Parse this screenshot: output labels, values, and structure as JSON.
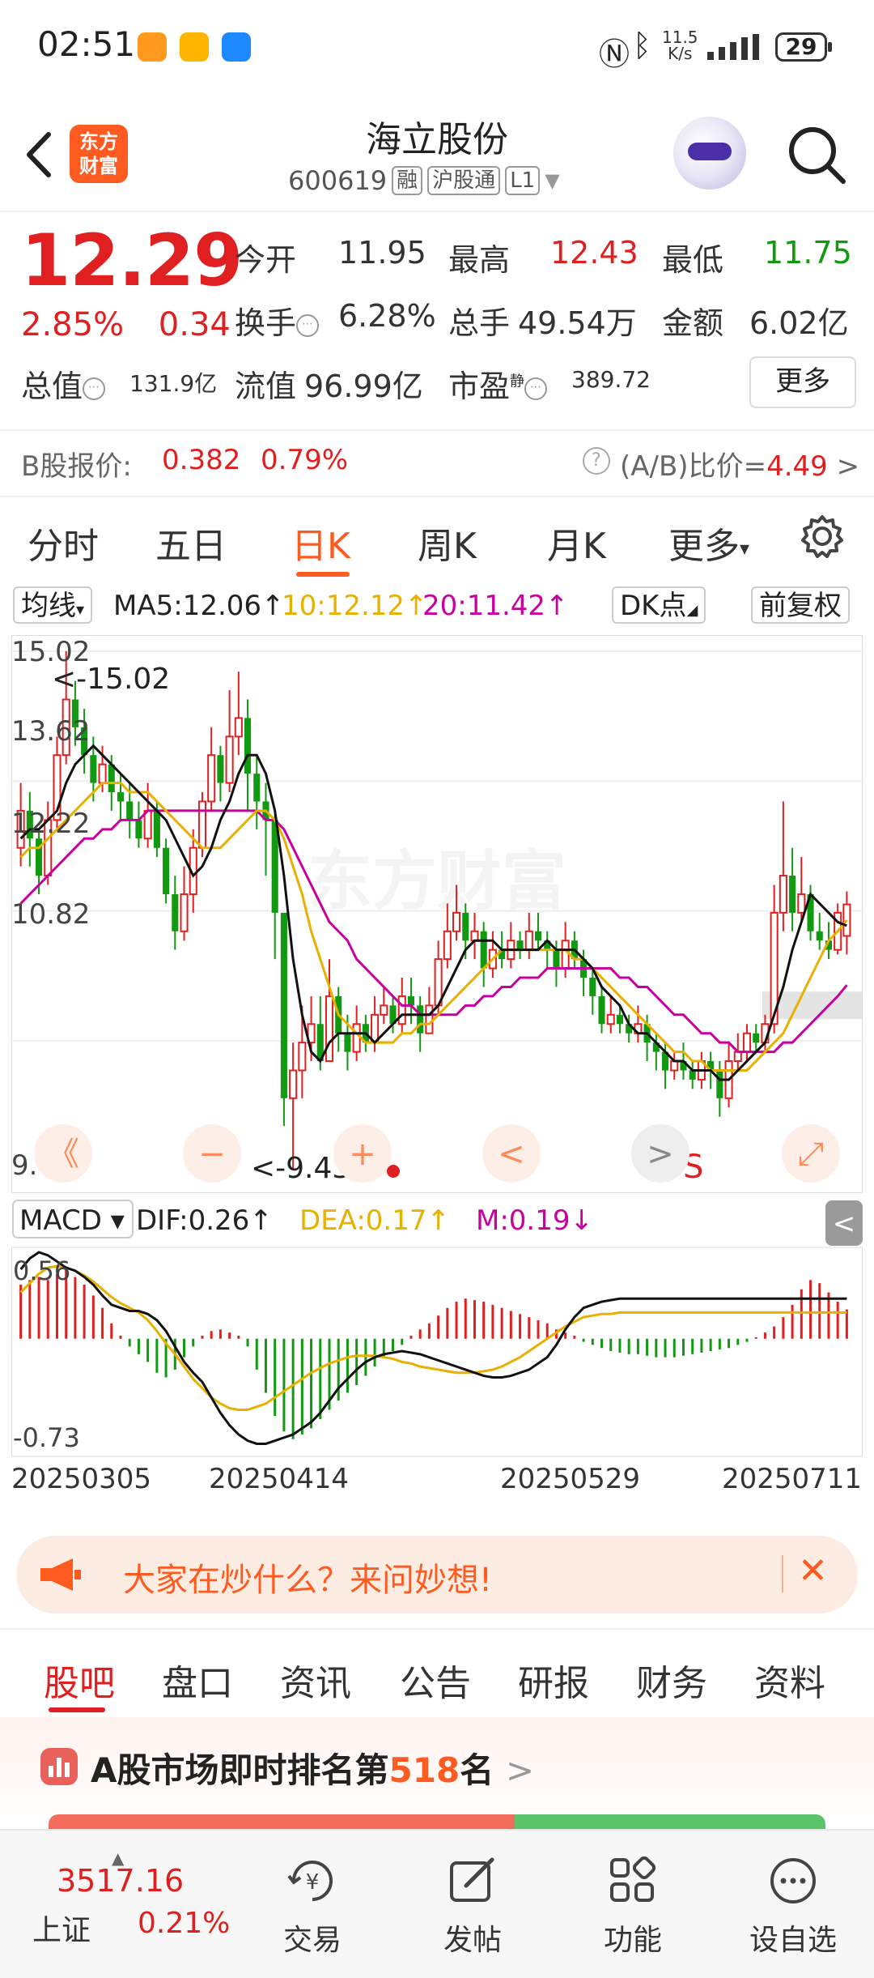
{
  "status_bar": {
    "time": "02:51",
    "net_speed": "11.5\nK/s",
    "net_speed_value": "11.5",
    "net_speed_unit": "K/s",
    "battery": "29"
  },
  "header": {
    "brand_logo_text": "东方财富",
    "brand_logo_line1": "东方",
    "brand_logo_line2": "财富",
    "title": "海立股份",
    "code": "600619",
    "tag_rong": "融",
    "tag_hgt": "沪股通",
    "tag_level": "L1"
  },
  "quote": {
    "price": "12.29",
    "change_pct": "2.85%",
    "change_amt": "0.34",
    "open_label": "今开",
    "open": "11.95",
    "high_label": "最高",
    "high": "12.43",
    "low_label": "最低",
    "low": "11.75",
    "turnover_label": "换手",
    "turnover": "6.28%",
    "volume_label": "总手",
    "volume": "49.54万",
    "amount_label": "金额",
    "amount": "6.02亿",
    "mktcap_label": "总值",
    "mktcap": "131.9亿",
    "float_label": "流值",
    "float_cap": "96.99亿",
    "pe_label": "市盈",
    "pe_sup": "静",
    "pe": "389.72",
    "more_button": "更多"
  },
  "bshare": {
    "label": "B股报价:",
    "price": "0.382",
    "pct": "0.79%",
    "ratio_label": "(A/B)比价=",
    "ratio": "4.49",
    "chevron": ">"
  },
  "period_tabs": [
    "分时",
    "五日",
    "日K",
    "周K",
    "月K",
    "更多"
  ],
  "period_active": "日K",
  "ma_row": {
    "indicator": "均线",
    "ma5": "MA5:12.06↑",
    "ma10": "10:12.12↑",
    "ma20": "20:11.42↑",
    "dk_button": "DK点",
    "adjust_button": "前复权"
  },
  "kline": {
    "axis_labels": [
      "15.02",
      "13.62",
      "12.22",
      "10.82",
      "9.43"
    ],
    "max_marker": "<-15.02",
    "min_marker": "<-9.43",
    "signal_mark": "S",
    "ctrl_rewind": "《",
    "ctrl_zoom_out": "−",
    "ctrl_zoom_in": "+",
    "ctrl_prev": "<",
    "ctrl_next": ">",
    "ctrl_expand": "⤢",
    "watermark": "东方财富"
  },
  "macd_row": {
    "indicator": "MACD",
    "dif": "DIF:0.26↑",
    "dea": "DEA:0.17↑",
    "m": "M:0.19↓",
    "axis_top": "0.56",
    "axis_bottom": "-0.73",
    "collapse": "<"
  },
  "dates": [
    "20250305",
    "20250414",
    "20250529",
    "20250711"
  ],
  "ad": {
    "text": "大家在炒什么？来问妙想!",
    "close": "✕"
  },
  "bottom_tabs": [
    "股吧",
    "盘口",
    "资讯",
    "公告",
    "研报",
    "财务",
    "资料"
  ],
  "bottom_tab_active": "股吧",
  "rank": {
    "prefix": "A股市场即时排名第",
    "value": "518",
    "suffix": "名",
    "chevron": ">"
  },
  "bottom_nav": {
    "index_value": "3517.16",
    "index_name": "上证",
    "index_pct": "0.21%",
    "items": [
      "交易",
      "发帖",
      "功能",
      "设自选"
    ]
  },
  "colors": {
    "up": "#e02020",
    "down": "#119911",
    "accent": "#ff5a1f",
    "ma5": "#111111",
    "ma10": "#e8b000",
    "ma20": "#c8009f"
  },
  "chart_data": {
    "type": "candlestick",
    "title": "",
    "ylim": [
      9.43,
      15.02
    ],
    "x_labels": [
      "20250305",
      "20250414",
      "20250529",
      "20250711"
    ],
    "candles": [
      [
        12.9,
        13.3,
        13.6,
        12.7
      ],
      [
        13.3,
        13.0,
        13.5,
        12.7
      ],
      [
        13.0,
        12.6,
        13.1,
        12.4
      ],
      [
        12.6,
        13.2,
        13.4,
        12.5
      ],
      [
        13.2,
        13.9,
        14.1,
        13.1
      ],
      [
        13.9,
        14.5,
        15.02,
        13.8
      ],
      [
        14.5,
        14.2,
        14.7,
        14.0
      ],
      [
        14.2,
        13.9,
        14.4,
        13.7
      ],
      [
        13.9,
        13.6,
        14.1,
        13.4
      ],
      [
        13.6,
        13.8,
        14.0,
        13.5
      ],
      [
        13.8,
        13.5,
        13.9,
        13.3
      ],
      [
        13.5,
        13.4,
        13.7,
        13.2
      ],
      [
        13.4,
        13.2,
        13.6,
        13.0
      ],
      [
        13.2,
        13.0,
        13.4,
        12.9
      ],
      [
        13.0,
        13.3,
        13.6,
        12.9
      ],
      [
        13.3,
        12.9,
        13.4,
        12.8
      ],
      [
        12.9,
        12.4,
        13.0,
        12.3
      ],
      [
        12.4,
        12.0,
        12.6,
        11.8
      ],
      [
        12.0,
        12.4,
        12.7,
        11.9
      ],
      [
        12.4,
        12.9,
        13.1,
        12.2
      ],
      [
        12.9,
        13.4,
        13.5,
        12.8
      ],
      [
        13.4,
        13.9,
        14.2,
        13.3
      ],
      [
        13.9,
        13.6,
        14.0,
        13.4
      ],
      [
        13.6,
        14.1,
        14.6,
        13.5
      ],
      [
        14.1,
        14.3,
        14.8,
        13.9
      ],
      [
        14.3,
        13.7,
        14.5,
        13.3
      ],
      [
        13.7,
        13.4,
        13.9,
        13.1
      ],
      [
        13.4,
        13.2,
        13.6,
        12.6
      ],
      [
        13.2,
        12.2,
        13.3,
        11.7
      ],
      [
        12.2,
        10.2,
        11.2,
        9.9
      ],
      [
        10.2,
        10.5,
        10.8,
        9.43
      ],
      [
        10.5,
        10.8,
        11.2,
        10.2
      ],
      [
        10.8,
        11.0,
        11.3,
        10.6
      ],
      [
        11.0,
        10.6,
        11.3,
        10.5
      ],
      [
        10.6,
        11.3,
        11.7,
        10.6
      ],
      [
        11.3,
        10.9,
        11.4,
        10.7
      ],
      [
        10.9,
        10.7,
        11.1,
        10.5
      ],
      [
        10.7,
        11.0,
        11.2,
        10.6
      ],
      [
        11.0,
        10.8,
        11.1,
        10.7
      ],
      [
        10.8,
        11.1,
        11.3,
        10.7
      ],
      [
        11.1,
        11.2,
        11.4,
        11.0
      ],
      [
        11.2,
        11.0,
        11.3,
        10.9
      ],
      [
        11.0,
        11.3,
        11.5,
        10.9
      ],
      [
        11.3,
        11.2,
        11.5,
        11.0
      ],
      [
        11.2,
        10.9,
        11.3,
        10.7
      ],
      [
        10.9,
        11.2,
        11.4,
        10.9
      ],
      [
        11.2,
        11.7,
        11.9,
        11.1
      ],
      [
        11.7,
        12.0,
        12.3,
        11.6
      ],
      [
        12.0,
        12.2,
        12.5,
        11.9
      ],
      [
        12.2,
        11.9,
        12.3,
        11.7
      ],
      [
        11.9,
        12.0,
        12.2,
        11.7
      ],
      [
        12.0,
        11.6,
        12.1,
        11.4
      ],
      [
        11.6,
        11.8,
        12.0,
        11.5
      ],
      [
        11.8,
        11.7,
        12.0,
        11.6
      ],
      [
        11.7,
        11.9,
        12.1,
        11.6
      ],
      [
        11.9,
        11.8,
        12.0,
        11.7
      ],
      [
        11.8,
        12.0,
        12.2,
        11.7
      ],
      [
        12.0,
        11.9,
        12.2,
        11.8
      ],
      [
        11.9,
        11.8,
        12.0,
        11.6
      ],
      [
        11.8,
        11.6,
        11.9,
        11.4
      ],
      [
        11.6,
        11.9,
        12.1,
        11.5
      ],
      [
        11.9,
        11.7,
        12.0,
        11.6
      ],
      [
        11.7,
        11.5,
        11.8,
        11.3
      ],
      [
        11.5,
        11.3,
        11.6,
        11.1
      ],
      [
        11.3,
        11.0,
        11.4,
        10.9
      ],
      [
        11.0,
        11.1,
        11.3,
        10.9
      ],
      [
        11.1,
        11.0,
        11.2,
        10.9
      ],
      [
        11.0,
        10.9,
        11.1,
        10.8
      ],
      [
        10.9,
        11.0,
        11.2,
        10.8
      ],
      [
        11.0,
        10.8,
        11.1,
        10.6
      ],
      [
        10.8,
        10.7,
        10.9,
        10.5
      ],
      [
        10.7,
        10.5,
        10.8,
        10.3
      ],
      [
        10.5,
        10.6,
        10.7,
        10.4
      ],
      [
        10.6,
        10.5,
        10.8,
        10.4
      ],
      [
        10.5,
        10.4,
        10.6,
        10.3
      ],
      [
        10.4,
        10.6,
        10.7,
        10.3
      ],
      [
        10.6,
        10.5,
        10.7,
        10.3
      ],
      [
        10.5,
        10.2,
        10.6,
        10.0
      ],
      [
        10.2,
        10.6,
        10.8,
        10.1
      ],
      [
        10.6,
        10.7,
        10.9,
        10.5
      ],
      [
        10.7,
        10.9,
        11.0,
        10.6
      ],
      [
        10.9,
        10.8,
        11.0,
        10.7
      ],
      [
        10.8,
        11.0,
        11.1,
        10.7
      ],
      [
        11.0,
        12.2,
        12.5,
        10.9
      ],
      [
        12.2,
        12.6,
        13.4,
        12.0
      ],
      [
        12.6,
        12.2,
        12.9,
        12.0
      ],
      [
        12.2,
        12.4,
        12.8,
        12.1
      ],
      [
        12.4,
        12.0,
        12.5,
        11.9
      ],
      [
        12.0,
        11.9,
        12.2,
        11.8
      ],
      [
        11.9,
        11.8,
        12.1,
        11.7
      ],
      [
        11.8,
        12.2,
        12.3,
        11.75
      ],
      [
        11.95,
        12.29,
        12.43,
        11.75
      ]
    ],
    "ma5": [
      13.0,
      13.1,
      13.1,
      13.2,
      13.3,
      13.6,
      13.8,
      13.9,
      14.0,
      13.9,
      13.8,
      13.7,
      13.6,
      13.5,
      13.4,
      13.3,
      13.2,
      13.0,
      12.8,
      12.6,
      12.7,
      12.9,
      13.2,
      13.4,
      13.7,
      13.9,
      13.9,
      13.7,
      13.3,
      12.6,
      11.7,
      11.1,
      10.7,
      10.6,
      10.8,
      10.9,
      10.9,
      10.9,
      10.9,
      10.8,
      10.9,
      11.0,
      11.1,
      11.1,
      11.1,
      11.1,
      11.2,
      11.4,
      11.6,
      11.8,
      11.9,
      11.9,
      11.9,
      11.8,
      11.8,
      11.8,
      11.8,
      11.8,
      11.9,
      11.8,
      11.8,
      11.8,
      11.7,
      11.6,
      11.4,
      11.3,
      11.2,
      11.0,
      10.9,
      10.9,
      10.8,
      10.7,
      10.6,
      10.6,
      10.5,
      10.5,
      10.5,
      10.4,
      10.4,
      10.5,
      10.6,
      10.7,
      10.8,
      11.1,
      11.4,
      11.8,
      12.1,
      12.4,
      12.3,
      12.2,
      12.1,
      12.06
    ],
    "ma10": [
      12.8,
      12.9,
      12.9,
      13.0,
      13.1,
      13.2,
      13.3,
      13.4,
      13.5,
      13.6,
      13.6,
      13.6,
      13.5,
      13.5,
      13.5,
      13.4,
      13.3,
      13.2,
      13.1,
      13.0,
      12.9,
      12.9,
      12.9,
      13.0,
      13.1,
      13.2,
      13.3,
      13.3,
      13.2,
      13.0,
      12.7,
      12.4,
      12.0,
      11.7,
      11.4,
      11.1,
      11.0,
      10.9,
      10.8,
      10.8,
      10.8,
      10.8,
      10.9,
      10.9,
      11.0,
      11.0,
      11.1,
      11.2,
      11.3,
      11.4,
      11.5,
      11.6,
      11.7,
      11.8,
      11.8,
      11.8,
      11.8,
      11.8,
      11.8,
      11.8,
      11.8,
      11.7,
      11.7,
      11.6,
      11.5,
      11.4,
      11.3,
      11.2,
      11.1,
      11.0,
      10.9,
      10.8,
      10.7,
      10.7,
      10.6,
      10.6,
      10.5,
      10.5,
      10.5,
      10.5,
      10.5,
      10.6,
      10.7,
      10.8,
      10.9,
      11.1,
      11.3,
      11.5,
      11.7,
      11.9,
      12.0,
      12.12
    ],
    "ma20": [
      12.3,
      12.4,
      12.5,
      12.6,
      12.7,
      12.8,
      12.9,
      13.0,
      13.0,
      13.1,
      13.1,
      13.2,
      13.2,
      13.2,
      13.3,
      13.3,
      13.3,
      13.3,
      13.3,
      13.3,
      13.3,
      13.3,
      13.3,
      13.3,
      13.3,
      13.3,
      13.3,
      13.2,
      13.2,
      13.1,
      12.9,
      12.7,
      12.5,
      12.3,
      12.1,
      12.0,
      11.9,
      11.7,
      11.6,
      11.5,
      11.4,
      11.3,
      11.2,
      11.2,
      11.1,
      11.1,
      11.1,
      11.1,
      11.1,
      11.2,
      11.2,
      11.3,
      11.3,
      11.4,
      11.4,
      11.5,
      11.5,
      11.5,
      11.6,
      11.6,
      11.6,
      11.6,
      11.6,
      11.6,
      11.6,
      11.6,
      11.5,
      11.5,
      11.4,
      11.4,
      11.3,
      11.2,
      11.1,
      11.1,
      11.0,
      10.9,
      10.9,
      10.8,
      10.8,
      10.7,
      10.7,
      10.7,
      10.7,
      10.7,
      10.8,
      10.8,
      10.9,
      11.0,
      11.1,
      11.2,
      11.3,
      11.42
    ],
    "macd_hist": [
      0.35,
      0.38,
      0.4,
      0.38,
      0.42,
      0.45,
      0.4,
      0.35,
      0.28,
      0.2,
      0.1,
      0.02,
      -0.05,
      -0.1,
      -0.15,
      -0.22,
      -0.25,
      -0.2,
      -0.12,
      -0.05,
      0.02,
      0.05,
      0.06,
      0.04,
      0.02,
      -0.05,
      -0.2,
      -0.35,
      -0.5,
      -0.6,
      -0.65,
      -0.62,
      -0.58,
      -0.52,
      -0.46,
      -0.4,
      -0.35,
      -0.3,
      -0.24,
      -0.18,
      -0.12,
      -0.08,
      -0.04,
      0.02,
      0.06,
      0.1,
      0.15,
      0.2,
      0.24,
      0.26,
      0.25,
      0.24,
      0.22,
      0.2,
      0.18,
      0.16,
      0.14,
      0.12,
      0.1,
      0.06,
      0.04,
      0.02,
      -0.02,
      -0.04,
      -0.06,
      -0.08,
      -0.09,
      -0.1,
      -0.1,
      -0.11,
      -0.12,
      -0.12,
      -0.12,
      -0.11,
      -0.1,
      -0.09,
      -0.08,
      -0.07,
      -0.06,
      -0.04,
      -0.02,
      0.01,
      0.04,
      0.08,
      0.14,
      0.22,
      0.32,
      0.38,
      0.36,
      0.3,
      0.24,
      0.19
    ],
    "dif": [
      0.45,
      0.52,
      0.56,
      0.54,
      0.5,
      0.46,
      0.44,
      0.4,
      0.35,
      0.28,
      0.22,
      0.2,
      0.18,
      0.18,
      0.16,
      0.12,
      0.05,
      -0.05,
      -0.15,
      -0.22,
      -0.28,
      -0.38,
      -0.48,
      -0.56,
      -0.62,
      -0.66,
      -0.68,
      -0.68,
      -0.66,
      -0.64,
      -0.62,
      -0.58,
      -0.54,
      -0.48,
      -0.4,
      -0.32,
      -0.26,
      -0.2,
      -0.15,
      -0.12,
      -0.1,
      -0.09,
      -0.08,
      -0.09,
      -0.1,
      -0.12,
      -0.14,
      -0.16,
      -0.18,
      -0.2,
      -0.22,
      -0.24,
      -0.25,
      -0.25,
      -0.24,
      -0.22,
      -0.2,
      -0.16,
      -0.12,
      -0.04,
      0.06,
      0.14,
      0.2,
      0.22,
      0.24,
      0.25,
      0.26,
      0.26,
      0.26,
      0.26,
      0.26,
      0.26,
      0.26,
      0.26,
      0.26,
      0.26,
      0.26,
      0.26,
      0.26,
      0.26,
      0.26,
      0.26,
      0.26,
      0.26,
      0.26,
      0.26,
      0.26,
      0.26,
      0.26,
      0.26,
      0.26,
      0.26
    ],
    "dea": [
      0.3,
      0.36,
      0.42,
      0.46,
      0.47,
      0.46,
      0.44,
      0.41,
      0.37,
      0.32,
      0.27,
      0.23,
      0.2,
      0.17,
      0.12,
      0.05,
      -0.03,
      -0.1,
      -0.18,
      -0.26,
      -0.32,
      -0.38,
      -0.42,
      -0.45,
      -0.46,
      -0.46,
      -0.44,
      -0.42,
      -0.38,
      -0.34,
      -0.3,
      -0.26,
      -0.22,
      -0.19,
      -0.16,
      -0.14,
      -0.12,
      -0.11,
      -0.11,
      -0.11,
      -0.12,
      -0.13,
      -0.15,
      -0.16,
      -0.18,
      -0.19,
      -0.2,
      -0.21,
      -0.22,
      -0.22,
      -0.22,
      -0.21,
      -0.2,
      -0.18,
      -0.15,
      -0.12,
      -0.08,
      -0.04,
      0.0,
      0.04,
      0.08,
      0.11,
      0.14,
      0.15,
      0.16,
      0.16,
      0.17,
      0.17,
      0.17,
      0.17,
      0.17,
      0.17,
      0.17,
      0.17,
      0.17,
      0.17,
      0.17,
      0.17,
      0.17,
      0.17,
      0.17,
      0.17,
      0.17,
      0.17,
      0.17,
      0.17,
      0.17,
      0.17,
      0.17,
      0.17,
      0.17,
      0.17
    ],
    "macd_ylim": [
      -0.73,
      0.56
    ]
  }
}
